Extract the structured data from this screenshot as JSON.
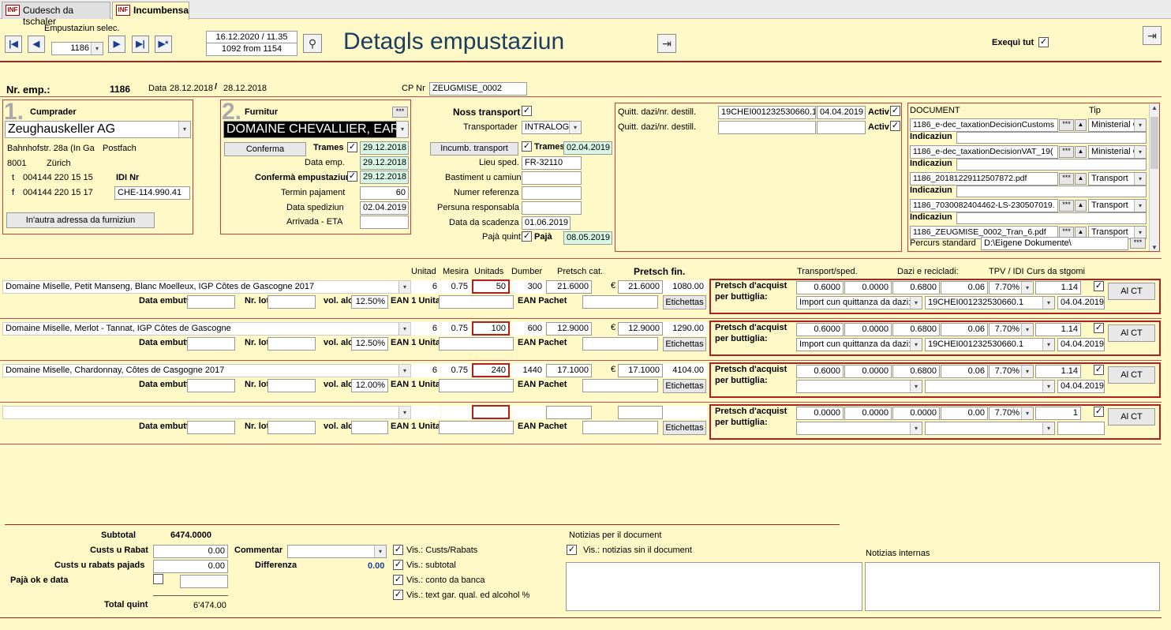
{
  "tabs": [
    {
      "label": "Cudesch da tschaler",
      "icon": "INF"
    },
    {
      "label": "Incumbensa",
      "icon": "INF"
    }
  ],
  "header": {
    "sel_label": "Empustaziun selec.",
    "sel_value": "1186",
    "datetime": "16.12.2020 / 11.35",
    "record": "1092 from 1154",
    "title": "Detagls empustaziun",
    "exequi_label": "Exequì tut"
  },
  "info": {
    "nr_label": "Nr. emp.:",
    "nr_value": "1186",
    "data_label": "Data",
    "data_from": "28.12.2018",
    "sep": "/",
    "data_to": "28.12.2018",
    "cp_label": "CP Nr",
    "cp_value": "ZEUGMISE_0002"
  },
  "buyer": {
    "num": "1.",
    "title": "Cumprader",
    "name": "Zeughauskeller AG",
    "street": "Bahnhofstr. 28a (In Ga",
    "postfach": "Postfach",
    "zip": "8001",
    "city": "Zürich",
    "t_label": "t",
    "t_value": "004144 220 15 15",
    "f_label": "f",
    "f_value": "004144 220 15 17",
    "idi_label": "IDI Nr",
    "idi_value": "CHE-114.990.41",
    "addr_btn": "In'autra adressa da furniziun"
  },
  "supplier": {
    "num": "2.",
    "title": "Furnitur",
    "more": "***",
    "name": "DOMAINE CHEVALLIER, EAR",
    "confirm_btn": "Conferma",
    "trames_label": "Trames",
    "trames_date": "29.12.2018",
    "data_emp_label": "Data emp.",
    "data_emp": "29.12.2018",
    "conf_emp_label": "Confermà empustaziun",
    "conf_emp": "29.12.2018",
    "termin_label": "Termin pajament",
    "termin": "60",
    "sped_label": "Data spediziun",
    "sped": "02.04.2019",
    "eta_label": "Arrivada - ETA",
    "eta": ""
  },
  "transport": {
    "noss_label": "Noss transport",
    "transp_label": "Transportader",
    "transp_value": "INTRALOG.",
    "incumb_btn": "Incumb. transport",
    "trames_label": "Trames",
    "trames_date": "02.04.2019",
    "lieu_label": "Lieu sped.",
    "lieu": "FR-32110",
    "bast_label": "Bastiment u camiun",
    "bast": "",
    "ref_label": "Numer referenza",
    "ref": "",
    "pers_label": "Persuna responsabla",
    "pers": "",
    "scad_label": "Data da scadenza",
    "scad": "01.06.2019",
    "quint_label": "Pajà quint",
    "paja_label": "Pajà",
    "paja_date": "08.05.2019"
  },
  "customs": {
    "label1": "Quitt. dazi/nr. destill.",
    "val1": "19CHEI001232530660.1",
    "date1": "04.04.2019",
    "activ1": "Activ",
    "label2": "Quitt. dazi/nr. destill.",
    "val2": "",
    "date2": "",
    "activ2": "Activ"
  },
  "documents": {
    "col_doc": "DOCUMENT",
    "col_tip": "Tip",
    "items": [
      {
        "file": "1186_e-dec_taxationDecisionCustoms",
        "tip": "Ministerial C",
        "ind_label": "Indicaziun"
      },
      {
        "file": "1186_e-dec_taxationDecisionVAT_19(",
        "tip": "Ministerial C",
        "ind_label": "Indicaziun"
      },
      {
        "file": "1186_20181229112507872.pdf",
        "tip": "Transport",
        "ind_label": "Indicaziun"
      },
      {
        "file": "1186_7030082404462-LS-230507019.",
        "tip": "Transport",
        "ind_label": "Indicaziun"
      },
      {
        "file": "1186_ZEUGMISE_0002_Tran_6.pdf",
        "tip": "Transport",
        "ind_label": ""
      }
    ],
    "percurs_label": "Percurs standard",
    "percurs": "D:\\Eigene Dokumente\\",
    "more": "***"
  },
  "columns": {
    "unitad": "Unitad",
    "mesira": "Mesira",
    "unitads": "Unitads",
    "dumber": "Dumber",
    "pretsch_cat": "Pretsch cat.",
    "pretsch_fin": "Pretsch fin.",
    "transport": "Transport/sped.",
    "dazi": "Dazi e recicladi:",
    "tpv": "TPV / IDI",
    "curs": "Curs da stgomi"
  },
  "lines": [
    {
      "product": "Domaine Miselle, Petit Manseng, Blanc Moelleux, IGP Côtes de Gascogne 2017",
      "unitad": "6",
      "mesira": "0.75",
      "unitads": "50",
      "dumber": "300",
      "cat": "21.6000",
      "cur": "€",
      "fin": "21.6000",
      "total": "1080.00",
      "embutt_label": "Data embutt.",
      "lot_label": "Nr. lot",
      "alc_label": "vol. alc",
      "alc": "12.50%",
      "ean1_label": "EAN 1 Unita",
      "eanp_label": "EAN Pachet",
      "etik": "Etichettas",
      "acq1": "Pretsch d'acquist",
      "acq2": "per buttiglia:",
      "transp": "0.6000",
      "t2": "0.0000",
      "dazi": "0.6800",
      "d2": "0.06",
      "tpv": "7.70%",
      "curs": "1.14",
      "imp": "Import cun quittanza da dazi:",
      "quitt": "19CHEI001232530660.1",
      "qdate": "04.04.2019",
      "alct": "Al CT"
    },
    {
      "product": "Domaine Miselle, Merlot - Tannat, IGP Côtes de Gascogne",
      "unitad": "6",
      "mesira": "0.75",
      "unitads": "100",
      "dumber": "600",
      "cat": "12.9000",
      "cur": "€",
      "fin": "12.9000",
      "total": "1290.00",
      "embutt_label": "Data embutt.",
      "lot_label": "Nr. lot",
      "alc_label": "vol. alc",
      "alc": "12.50%",
      "ean1_label": "EAN 1 Unita",
      "eanp_label": "EAN Pachet",
      "etik": "Etichettas",
      "acq1": "Pretsch d'acquist",
      "acq2": "per buttiglia:",
      "transp": "0.6000",
      "t2": "0.0000",
      "dazi": "0.6800",
      "d2": "0.06",
      "tpv": "7.70%",
      "curs": "1.14",
      "imp": "Import cun quittanza da dazi:",
      "quitt": "19CHEI001232530660.1",
      "qdate": "04.04.2019",
      "alct": "Al CT"
    },
    {
      "product": "Domaine Miselle, Chardonnay, Côtes de Casgogne 2017",
      "unitad": "6",
      "mesira": "0.75",
      "unitads": "240",
      "dumber": "1440",
      "cat": "17.1000",
      "cur": "€",
      "fin": "17.1000",
      "total": "4104.00",
      "embutt_label": "Data embutt.",
      "lot_label": "Nr. lot",
      "alc_label": "vol. alc",
      "alc": "12.00%",
      "ean1_label": "EAN 1 Unita",
      "eanp_label": "EAN Pachet",
      "etik": "Etichettas",
      "acq1": "Pretsch d'acquist",
      "acq2": "per buttiglia:",
      "transp": "0.6000",
      "t2": "0.0000",
      "dazi": "0.6800",
      "d2": "0.06",
      "tpv": "7.70%",
      "curs": "1.14",
      "imp": "",
      "quitt": "",
      "qdate": "04.04.2019",
      "alct": "Al CT"
    },
    {
      "product": "",
      "unitad": "",
      "mesira": "",
      "unitads": "",
      "dumber": "",
      "cat": "",
      "cur": "",
      "fin": "",
      "total": "",
      "embutt_label": "Data embutt.",
      "lot_label": "Nr. lot",
      "alc_label": "vol. alc",
      "alc": "",
      "ean1_label": "EAN 1 Unita",
      "eanp_label": "EAN Pachet",
      "etik": "Etichettas",
      "acq1": "Pretsch d'acquist",
      "acq2": "per buttiglia:",
      "transp": "0.0000",
      "t2": "0.0000",
      "dazi": "0.0000",
      "d2": "0.00",
      "tpv": "7.70%",
      "curs": "1",
      "imp": "",
      "quitt": "",
      "qdate": "",
      "alct": "Al CT"
    }
  ],
  "footer": {
    "subtotal_label": "Subtotal",
    "subtotal": "6474.0000",
    "rabat_label": "Custs u Rabat",
    "rabat": "0.00",
    "rabat_paj_label": "Custs u rabats pajads",
    "rabat_paj": "0.00",
    "paja_ok_label": "Pajà ok e data",
    "total_label": "Total quint",
    "total": "6'474.00",
    "comment_label": "Commentar",
    "diff_label": "Differenza",
    "diff": "0.00",
    "vis1": "Vis.: Custs/Rabats",
    "vis2": "Vis.: subtotal",
    "vis3": "Vis.: conto da banca",
    "vis4": "Vis.: text gar. qual. ed alcohol %",
    "notes_label": "Notizias per il document",
    "notes_vis": "Vis.: notizias sin il document",
    "internal_label": "Notizias internas"
  },
  "colors": {
    "background": "#fff9c8",
    "accent_red": "#b32020",
    "title_blue": "#1a3e60",
    "highlight_green": "#d9f7e4"
  }
}
